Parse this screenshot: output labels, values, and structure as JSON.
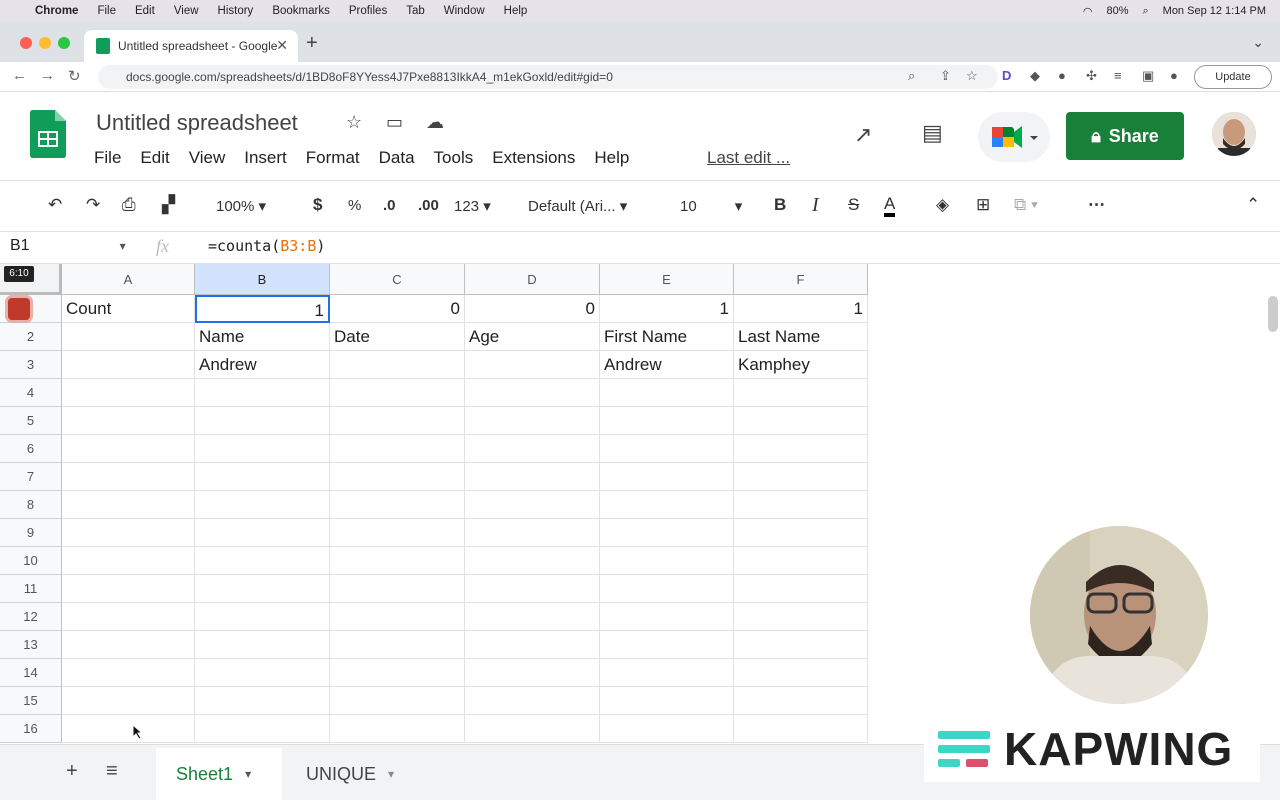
{
  "menubar": {
    "app": "Chrome",
    "items": [
      "File",
      "Edit",
      "View",
      "History",
      "Bookmarks",
      "Profiles",
      "Tab",
      "Window",
      "Help"
    ],
    "battery": "80%",
    "clock": "Mon Sep 12  1:14 PM"
  },
  "browser": {
    "tab_title": "Untitled spreadsheet - Google",
    "url": "docs.google.com/spreadsheets/d/1BD8oF8YYess4J7Pxe8813IkkA4_m1ekGoxld/edit#gid=0",
    "update_label": "Update"
  },
  "doc": {
    "title": "Untitled spreadsheet",
    "menus": [
      "File",
      "Edit",
      "View",
      "Insert",
      "Format",
      "Data",
      "Tools",
      "Extensions",
      "Help"
    ],
    "last_edit": "Last edit ...",
    "share_label": "Share"
  },
  "toolbar": {
    "zoom": "100%",
    "currency": "$",
    "percent": "%",
    "dec_decrease": ".0",
    "dec_increase": ".00",
    "format_more": "123",
    "font": "Default (Ari...",
    "font_size": "10",
    "bold": "B",
    "italic": "I",
    "strike": "S",
    "text_color": "A",
    "more": "⋯"
  },
  "formula_bar": {
    "cell_ref": "B1",
    "fx": "fx",
    "formula_prefix": "=counta(",
    "formula_range": "B3:B",
    "formula_suffix": ")"
  },
  "recording_timer": "6:10",
  "columns": [
    "A",
    "B",
    "C",
    "D",
    "E",
    "F"
  ],
  "rows": [
    [
      "Count",
      "1",
      "0",
      "0",
      "1",
      "1"
    ],
    [
      "",
      "Name",
      "Date",
      "Age",
      "First Name",
      "Last Name"
    ],
    [
      "",
      "Andrew",
      "",
      "",
      "Andrew",
      "Kamphey"
    ],
    [
      "",
      "",
      "",
      "",
      "",
      ""
    ],
    [
      "",
      "",
      "",
      "",
      "",
      ""
    ],
    [
      "",
      "",
      "",
      "",
      "",
      ""
    ],
    [
      "",
      "",
      "",
      "",
      "",
      ""
    ],
    [
      "",
      "",
      "",
      "",
      "",
      ""
    ],
    [
      "",
      "",
      "",
      "",
      "",
      ""
    ],
    [
      "",
      "",
      "",
      "",
      "",
      ""
    ],
    [
      "",
      "",
      "",
      "",
      "",
      ""
    ],
    [
      "",
      "",
      "",
      "",
      "",
      ""
    ],
    [
      "",
      "",
      "",
      "",
      "",
      ""
    ],
    [
      "",
      "",
      "",
      "",
      "",
      ""
    ],
    [
      "",
      "",
      "",
      "",
      "",
      ""
    ],
    [
      "",
      "",
      "",
      "",
      "",
      ""
    ]
  ],
  "row_numbers": [
    "",
    "2",
    "3",
    "4",
    "5",
    "6",
    "7",
    "8",
    "9",
    "10",
    "11",
    "12",
    "13",
    "14",
    "15",
    "16"
  ],
  "sheets": {
    "add": "+",
    "all": "≡",
    "tabs": [
      "Sheet1",
      "UNIQUE"
    ]
  },
  "watermark": "KAPWING"
}
